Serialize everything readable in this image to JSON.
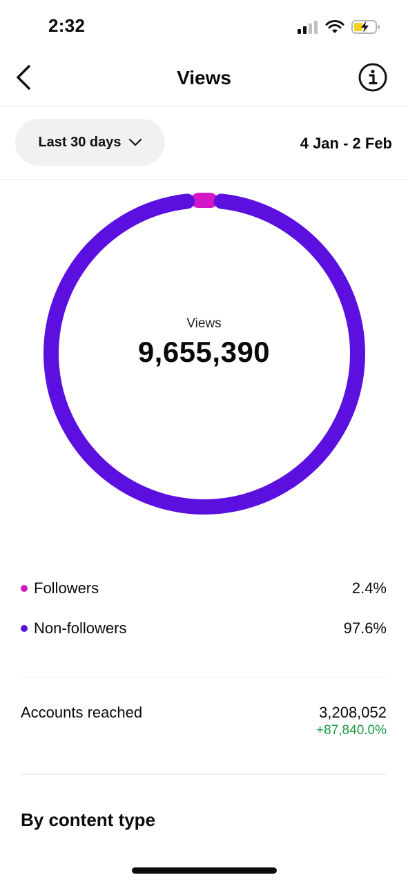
{
  "status_bar": {
    "time": "2:32",
    "icons": [
      "cellular-signal-icon",
      "wifi-icon",
      "battery-charging-icon"
    ]
  },
  "header": {
    "title": "Views",
    "back_icon": "chevron-left-icon",
    "info_icon": "info-icon"
  },
  "filters": {
    "period_label": "Last 30 days",
    "date_range": "4 Jan - 2 Feb"
  },
  "summary": {
    "label": "Views",
    "value": "9,655,390"
  },
  "chart_data": {
    "type": "pie",
    "categories": [
      "Followers",
      "Non-followers"
    ],
    "values": [
      2.4,
      97.6
    ],
    "colors": [
      "#d317c8",
      "#5b10e0"
    ],
    "title": ""
  },
  "breakdown": [
    {
      "label": "Followers",
      "value": "2.4%",
      "color": "#d317c8"
    },
    {
      "label": "Non-followers",
      "value": "97.6%",
      "color": "#5b10e0"
    }
  ],
  "accounts_reached": {
    "label": "Accounts reached",
    "value": "3,208,052",
    "change": "+87,840.0%"
  },
  "section": {
    "title": "By content type"
  }
}
